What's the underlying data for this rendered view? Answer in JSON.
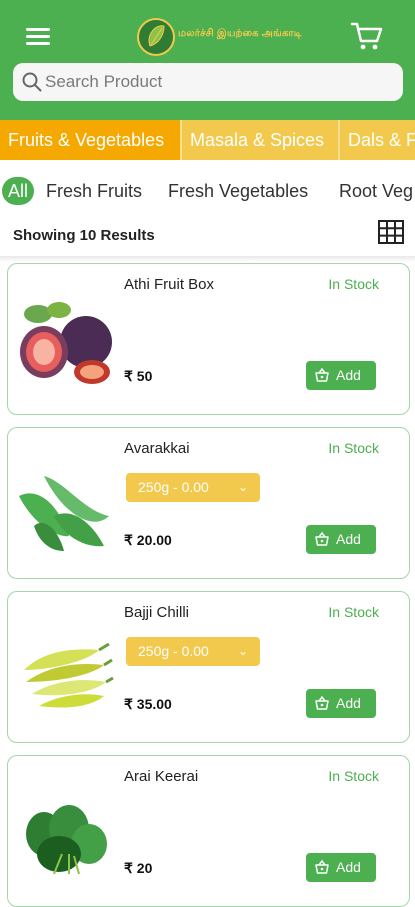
{
  "header": {
    "logo_text": "மலர்ச்சி இயற்கை அங்காடி",
    "search_placeholder": "Search Product"
  },
  "categories": [
    "Fruits & Vegetables",
    "Masala & Spices",
    "Dals & F"
  ],
  "subcategories": [
    "All",
    "Fresh Fruits",
    "Fresh Vegetables",
    "Root Veg"
  ],
  "results_label": "Showing 10 Results",
  "products": [
    {
      "name": "Athi Fruit Box",
      "stock": "In Stock",
      "price": "₹ 50",
      "variant": "",
      "add": "Add"
    },
    {
      "name": "Avarakkai",
      "stock": "In Stock",
      "price": "₹ 20.00",
      "variant": "250g - 0.00",
      "add": "Add"
    },
    {
      "name": "Bajji Chilli",
      "stock": "In Stock",
      "price": "₹ 35.00",
      "variant": "250g - 0.00",
      "add": "Add"
    },
    {
      "name": "Arai Keerai",
      "stock": "In Stock",
      "price": "₹ 20",
      "variant": "",
      "add": "Add"
    }
  ],
  "colors": {
    "primary": "#4caf50",
    "category_bar": "#f2c94c",
    "category_active": "#f5a800"
  }
}
